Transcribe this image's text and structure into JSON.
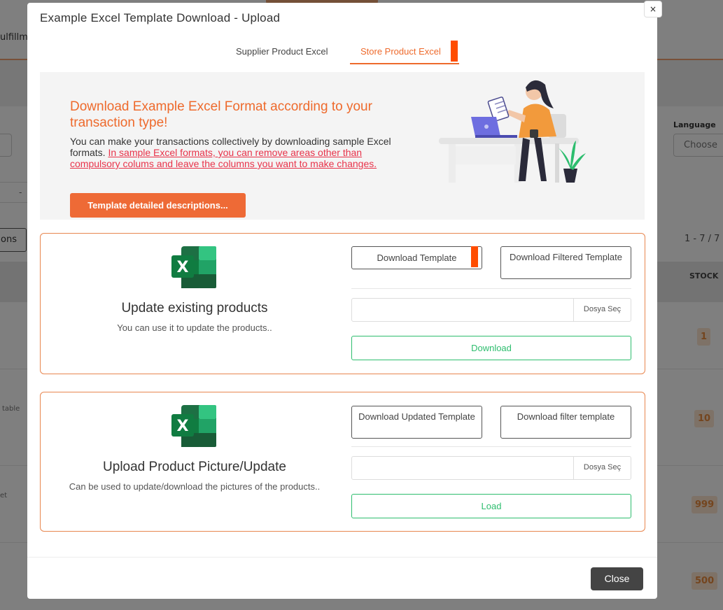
{
  "background": {
    "tab_fragment": "ulfillm",
    "language_label": "Language",
    "language_select": "Choose",
    "dash": "-",
    "options_fragment": "ons",
    "paging": "1 - 7 / 7",
    "stock_header": "STOCK",
    "row_texts": [
      "table",
      "et"
    ],
    "stock_values": [
      "1",
      "10",
      "999",
      "500"
    ]
  },
  "modal": {
    "title": "Example Excel Template Download - Upload",
    "close_x": "×",
    "tabs": [
      "Supplier Product Excel",
      "Store Product Excel"
    ],
    "banner": {
      "title": "Download Example Excel Format according to your transaction type!",
      "text_plain": "You can make your transactions collectively by downloading sample Excel formats. ",
      "text_link": "In sample Excel formats, you can remove areas other than compulsory colums and leave the columns you want to make changes.",
      "button": "Template detailed descriptions..."
    },
    "cards": [
      {
        "title": "Update existing products",
        "subtitle": "You can use it to update the products..",
        "btn_left": "Download Template",
        "btn_right": "Download Filtered Template",
        "file_button": "Dosya Seç",
        "action": "Download"
      },
      {
        "title": "Upload Product Picture/Update",
        "subtitle": "Can be used to update/download the pictures of the products..",
        "btn_left": "Download Updated Template",
        "btn_right": "Download filter template",
        "file_button": "Dosya Seç",
        "action": "Load"
      }
    ],
    "close_button": "Close"
  },
  "colors": {
    "accent": "#ee6a2c",
    "link": "#e8334a",
    "success": "#2dbd6e",
    "excel_green": "#1d7044"
  }
}
